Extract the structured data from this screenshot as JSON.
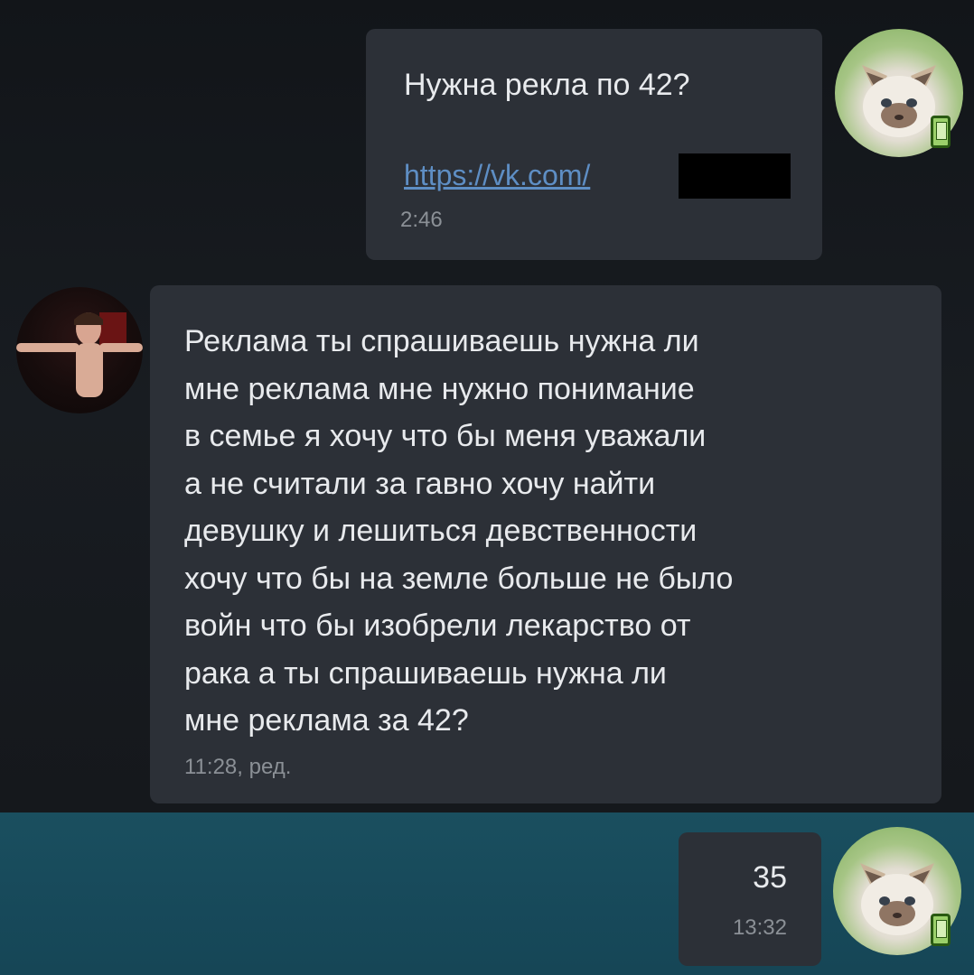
{
  "messages": [
    {
      "id": "msg-1",
      "direction": "outgoing",
      "text": "Нужна рекла по 42?",
      "link": "https://vk.com/",
      "time": "2:46"
    },
    {
      "id": "msg-2",
      "direction": "incoming",
      "text": "Реклама ты спрашиваешь нужна ли\nмне реклама мне нужно понимание\nв семье я хочу что бы меня уважали\nа не считали за гавно хочу найти\nдевушку и лешиться девственности\nхочу что бы на земле больше не было\nвойн что бы изобрели лекарство от\nрака а ты спрашиваешь нужна ли\nмне реклама за 42?",
      "time": "11:28, ред."
    },
    {
      "id": "msg-3",
      "direction": "outgoing",
      "text": "35",
      "time": "13:32"
    }
  ],
  "avatars": {
    "me": "cat-avatar",
    "other": "person-avatar"
  },
  "colors": {
    "background": "#16191e",
    "bubble": "#2c3037",
    "highlight": "#1a4f5f",
    "link": "#5e8ec4",
    "time": "#8b9096"
  }
}
